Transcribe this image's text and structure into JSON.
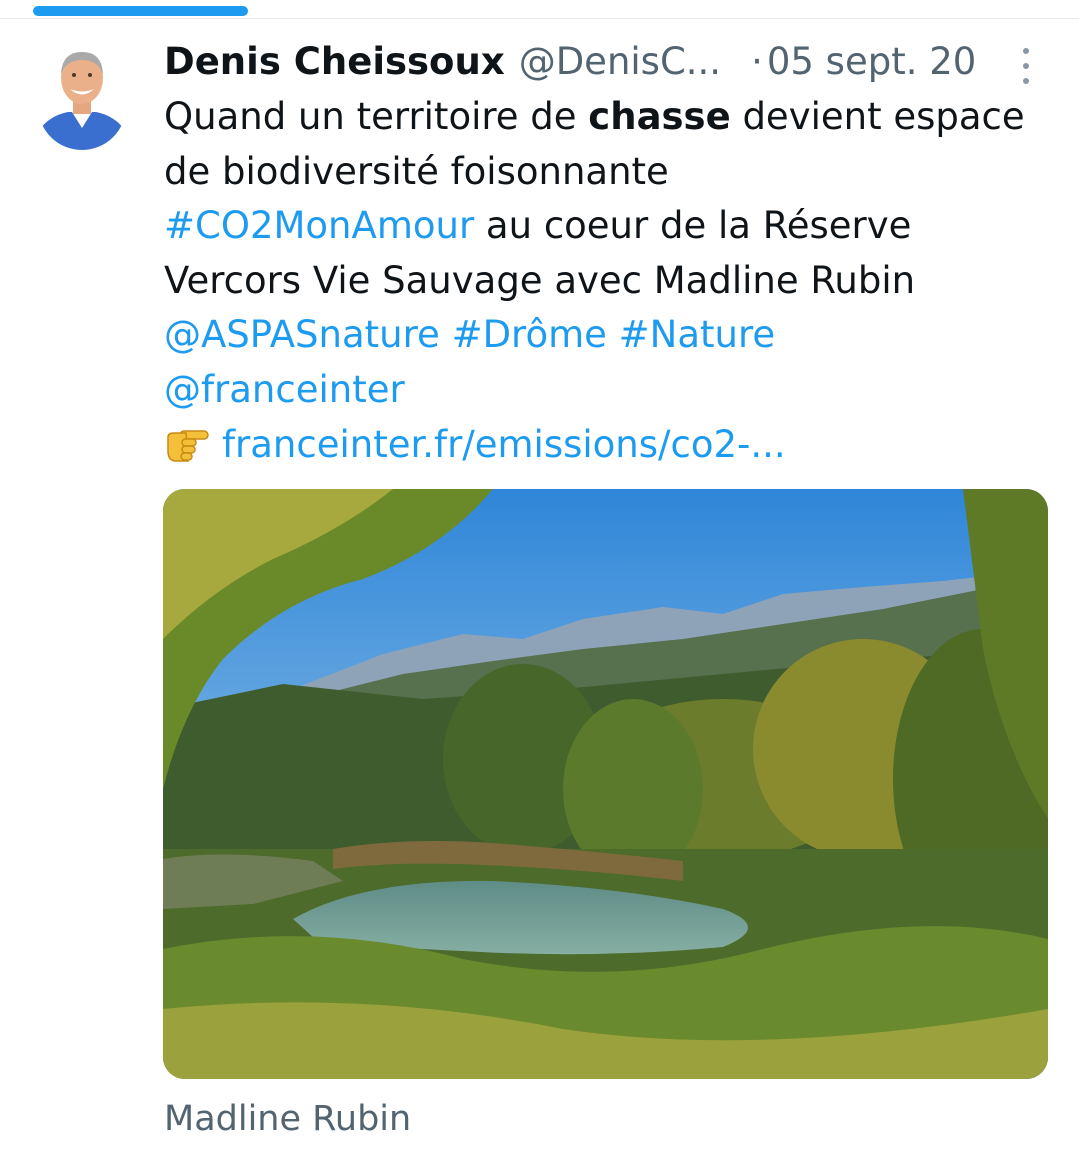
{
  "tweet": {
    "author_name": "Denis Cheissoux",
    "handle": "@DenisC...",
    "separator": "·",
    "date": "05 sept. 20",
    "text": {
      "line1_before": "Quand un territoire de ",
      "line1_bold": "chasse",
      "line1_after": " devient espace",
      "line2": "de biodiversité foisonnante",
      "hashtag_co2": "#CO2MonAmour",
      "line3_after": " au coeur de la Réserve",
      "line4": "Vercors Vie Sauvage avec Madline Rubin",
      "mention_aspas": "@ASPASnature",
      "hashtag_drome": "#Drôme",
      "hashtag_nature": "#Nature",
      "mention_franceinter": "@franceinter",
      "link": "franceinter.fr/emissions/co2-..."
    },
    "media": {
      "icon": "landscape-photo"
    },
    "caption": "Madline Rubin"
  },
  "icons": {
    "emoji": "pointing-hand-icon",
    "menu": "more-vertical-icon"
  },
  "colors": {
    "accent": "#1d9bf0",
    "text": "#0f1419",
    "secondary": "#536471",
    "divider": "#e6e9ec"
  }
}
